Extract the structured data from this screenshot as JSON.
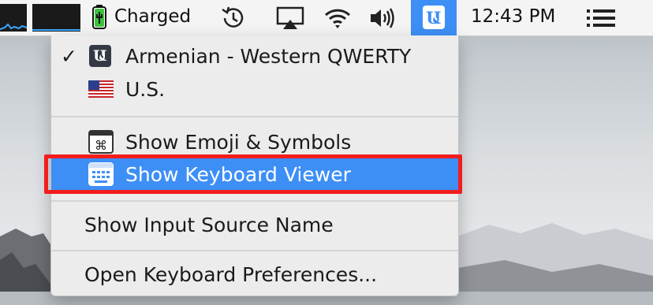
{
  "menubar": {
    "battery_status": "Charged",
    "clock": "12:43 PM",
    "icons": [
      "activity-graph-icon",
      "cpu-graph-icon",
      "battery-icon",
      "time-machine-icon",
      "airplay-icon",
      "wifi-icon",
      "volume-icon",
      "input-source-icon",
      "menu-list-icon"
    ]
  },
  "input_menu": {
    "sources": [
      {
        "label": "Armenian - Western QWERTY",
        "checked": true,
        "icon": "armenian-keyboard-icon"
      },
      {
        "label": "U.S.",
        "checked": false,
        "icon": "us-flag-icon"
      }
    ],
    "actions": [
      {
        "label": "Show Emoji & Symbols",
        "icon": "emoji-symbols-icon"
      },
      {
        "label": "Show Keyboard Viewer",
        "icon": "keyboard-viewer-icon",
        "highlighted": true
      }
    ],
    "show_name": "Show Input Source Name",
    "open_prefs": "Open Keyboard Preferences...",
    "checkmark": "✓"
  },
  "colors": {
    "menubar_bg": "#f4f4f4",
    "accent_blue": "#3d8ff5",
    "annotation_red": "#f21d1d",
    "menu_bg": "#ececec"
  }
}
